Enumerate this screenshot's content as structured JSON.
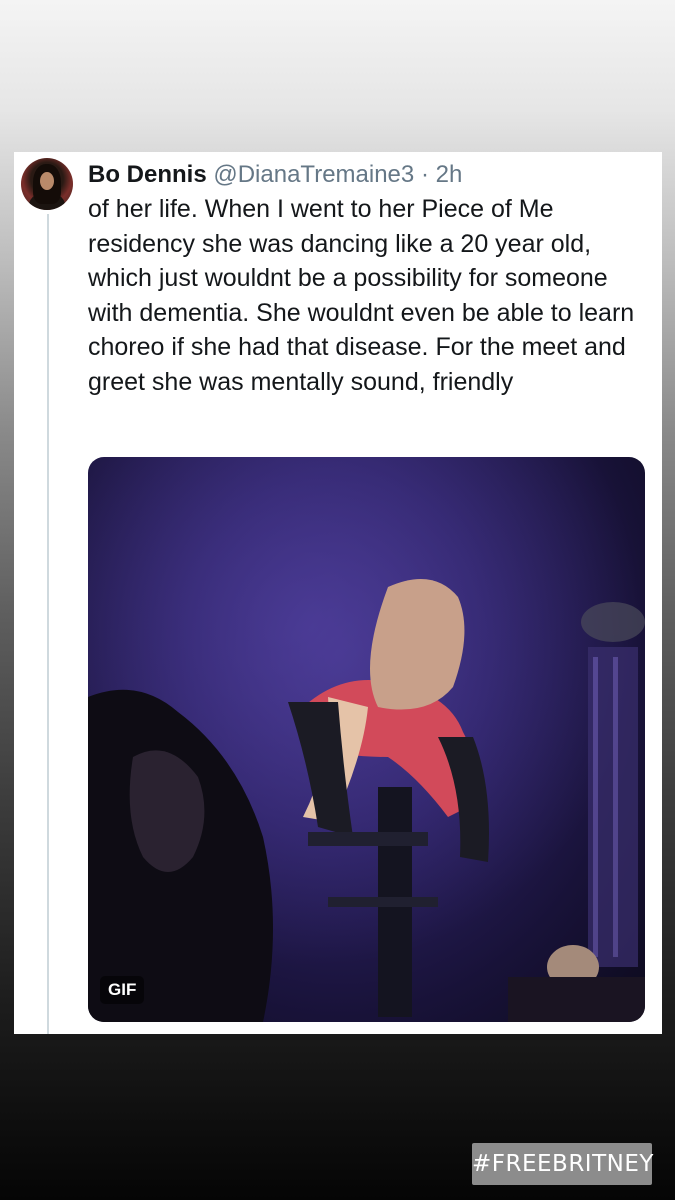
{
  "tweet": {
    "display_name": "Bo Dennis",
    "handle": "@DianaTremaine3",
    "separator": "·",
    "time": "2h",
    "text": "of her life. When I went to her Piece of Me residency she was dancing like a 20 year old, which just wouldnt be a possibility for someone with dementia. She wouldnt even be able to learn choreo if she had that disease. For the meet and greet she was mentally sound, friendly",
    "media": {
      "badge": "GIF"
    }
  },
  "story": {
    "hashtag_sticker": "#FREEBRITNEY"
  },
  "colors": {
    "card_background": "#ffffff",
    "primary_text": "#14171a",
    "secondary_text": "#657786",
    "sticker_background": "#8c8c8c"
  }
}
